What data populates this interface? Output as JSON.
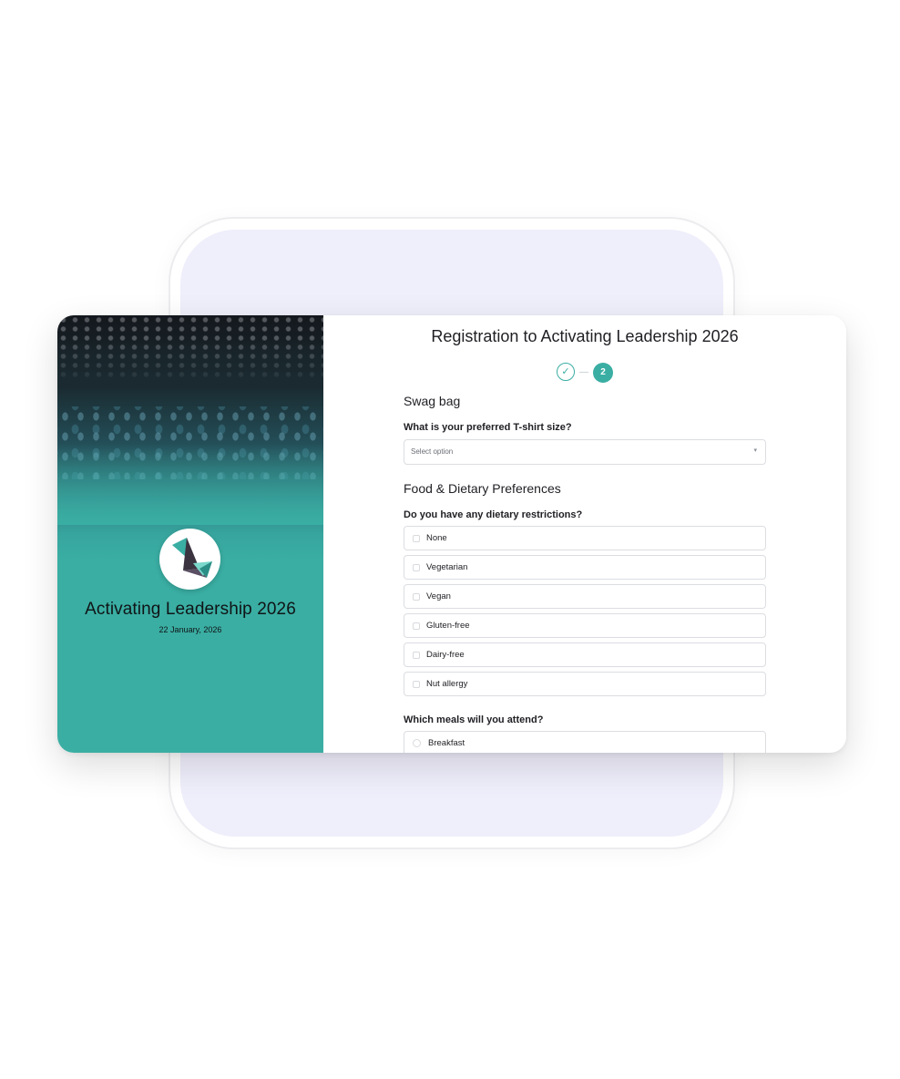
{
  "event": {
    "name": "Activating Leadership 2026",
    "date": "22 January, 2026"
  },
  "form": {
    "title": "Registration to Activating Leadership 2026",
    "stepper": {
      "completed_mark": "✓",
      "current_step": "2"
    },
    "sections": {
      "swag": {
        "heading": "Swag bag",
        "question": "What is your preferred T-shirt size?",
        "select": {
          "placeholder": "Select option",
          "chevron": "▾"
        }
      },
      "food": {
        "heading": "Food & Dietary Preferences",
        "dietary_question": "Do you have any dietary restrictions?",
        "dietary_options": [
          "None",
          "Vegetarian",
          "Vegan",
          "Gluten-free",
          "Dairy-free",
          "Nut allergy"
        ],
        "meals_question": "Which meals will you attend?",
        "meal_options": [
          "Breakfast"
        ]
      }
    }
  },
  "colors": {
    "accent": "#3aaea3",
    "background_frame": "#efeefb",
    "text": "#1f1f24"
  }
}
